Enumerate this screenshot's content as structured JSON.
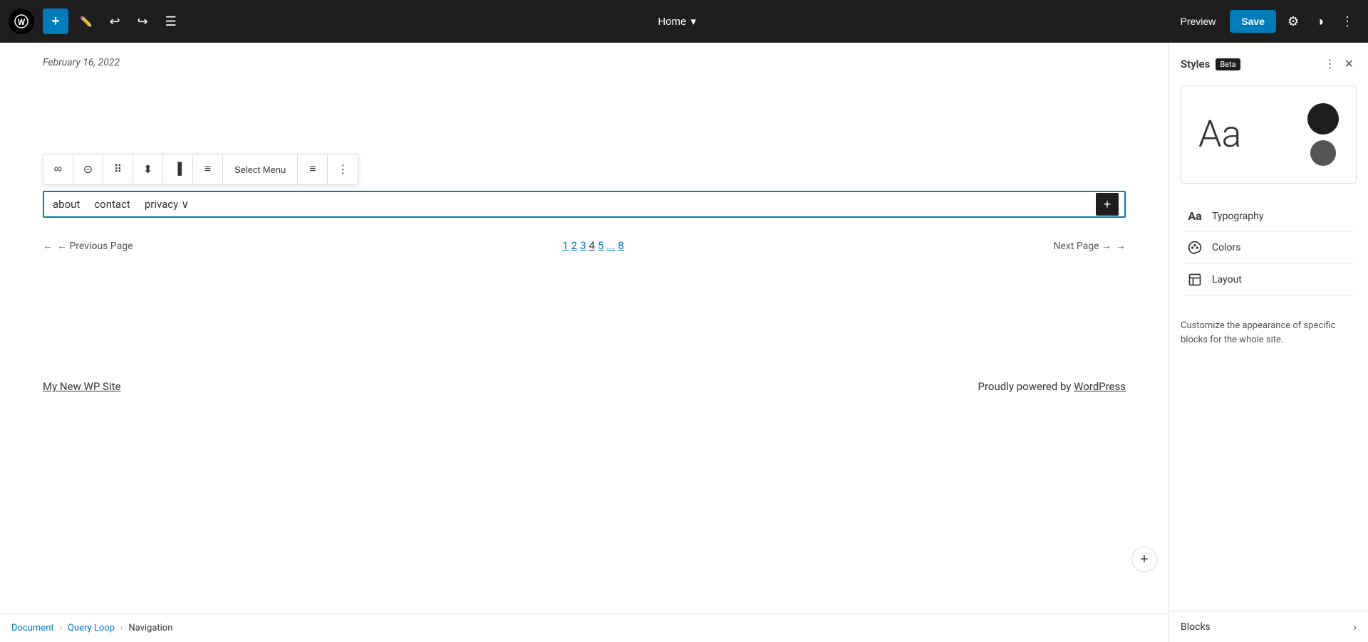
{
  "topbar": {
    "add_label": "+",
    "page_title": "Home",
    "page_chevron": "▾",
    "preview_label": "Preview",
    "save_label": "Save"
  },
  "canvas": {
    "date": "February 16, 2022",
    "nav_items": [
      "about",
      "contact",
      "privacy"
    ],
    "nav_has_dropdown": true,
    "pagination": {
      "prev_label": "← Previous Page",
      "next_label": "Next Page →",
      "pages": [
        "1",
        "2",
        "3",
        "4",
        "5",
        "...",
        "8"
      ]
    },
    "footer": {
      "site_name": "My New WP Site",
      "powered_text": "Proudly powered by ",
      "powered_link": "WordPress"
    }
  },
  "toolbar": {
    "buttons": [
      "∞",
      "⊙",
      "⠿",
      "⬍",
      "▐",
      "≡",
      "≡",
      "⋮"
    ]
  },
  "panel": {
    "title": "Styles",
    "beta_label": "Beta",
    "preview_text": "Aa",
    "typography_label": "Typography",
    "colors_label": "Colors",
    "layout_label": "Layout",
    "description": "Customize the appearance of specific blocks for the whole site.",
    "blocks_label": "Blocks"
  },
  "breadcrumb": {
    "items": [
      "Document",
      "Query Loop",
      "Navigation"
    ]
  }
}
